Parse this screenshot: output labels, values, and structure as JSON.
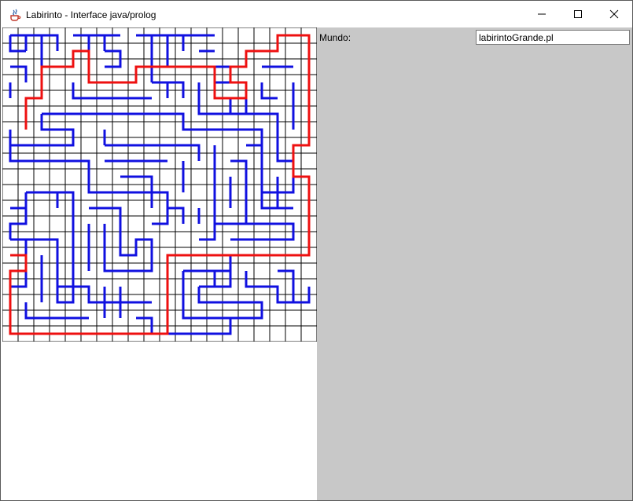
{
  "window": {
    "title": "Labirinto - Interface java/prolog",
    "icon": "java-cup-icon",
    "controls": [
      "minimize-icon",
      "maximize-icon",
      "close-icon"
    ]
  },
  "side_panel": {
    "mundo_label": "Mundo:",
    "mundo_value": "labirintoGrande.pl"
  },
  "maze": {
    "rows": 20,
    "cols": 20,
    "colors": {
      "grid": "#000000",
      "walls": "#1010e0",
      "path": "#ee1010",
      "panel_bg": "#c8c8c8"
    }
  }
}
